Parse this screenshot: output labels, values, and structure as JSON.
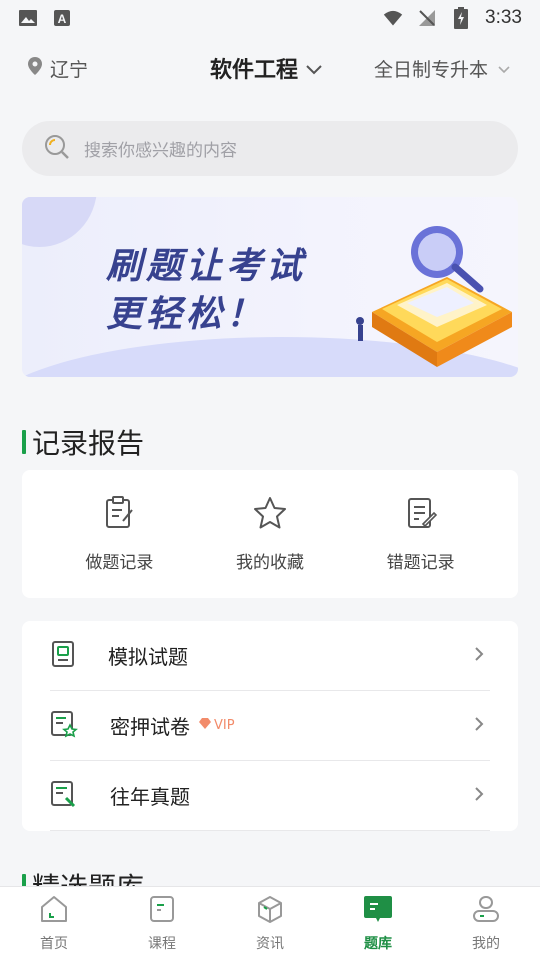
{
  "status_bar": {
    "time": "3:33"
  },
  "header": {
    "location": "辽宁",
    "subject": "软件工程",
    "level": "全日制专升本"
  },
  "search": {
    "placeholder": "搜索你感兴趣的内容"
  },
  "banner": {
    "line1": "刷题让考试",
    "line2": "更轻松！"
  },
  "records_section": {
    "title": "记录报告",
    "items": [
      {
        "label": "做题记录",
        "icon": "clipboard-icon"
      },
      {
        "label": "我的收藏",
        "icon": "star-icon"
      },
      {
        "label": "错题记录",
        "icon": "edit-note-icon"
      }
    ]
  },
  "list": {
    "items": [
      {
        "label": "模拟试题",
        "icon": "mock-exam-icon"
      },
      {
        "label": "密押试卷",
        "icon": "paper-star-icon",
        "badge": "VIP"
      },
      {
        "label": "往年真题",
        "icon": "past-paper-icon"
      }
    ]
  },
  "next_section": {
    "title": "精选题库"
  },
  "bottom_nav": {
    "items": [
      {
        "label": "首页",
        "icon": "home-icon"
      },
      {
        "label": "课程",
        "icon": "course-icon"
      },
      {
        "label": "资讯",
        "icon": "news-icon"
      },
      {
        "label": "题库",
        "icon": "question-bank-icon",
        "active": true
      },
      {
        "label": "我的",
        "icon": "profile-icon"
      }
    ]
  },
  "colors": {
    "accent": "#1aa04a",
    "banner_text": "#37428f",
    "vip": "#f28b6a"
  }
}
